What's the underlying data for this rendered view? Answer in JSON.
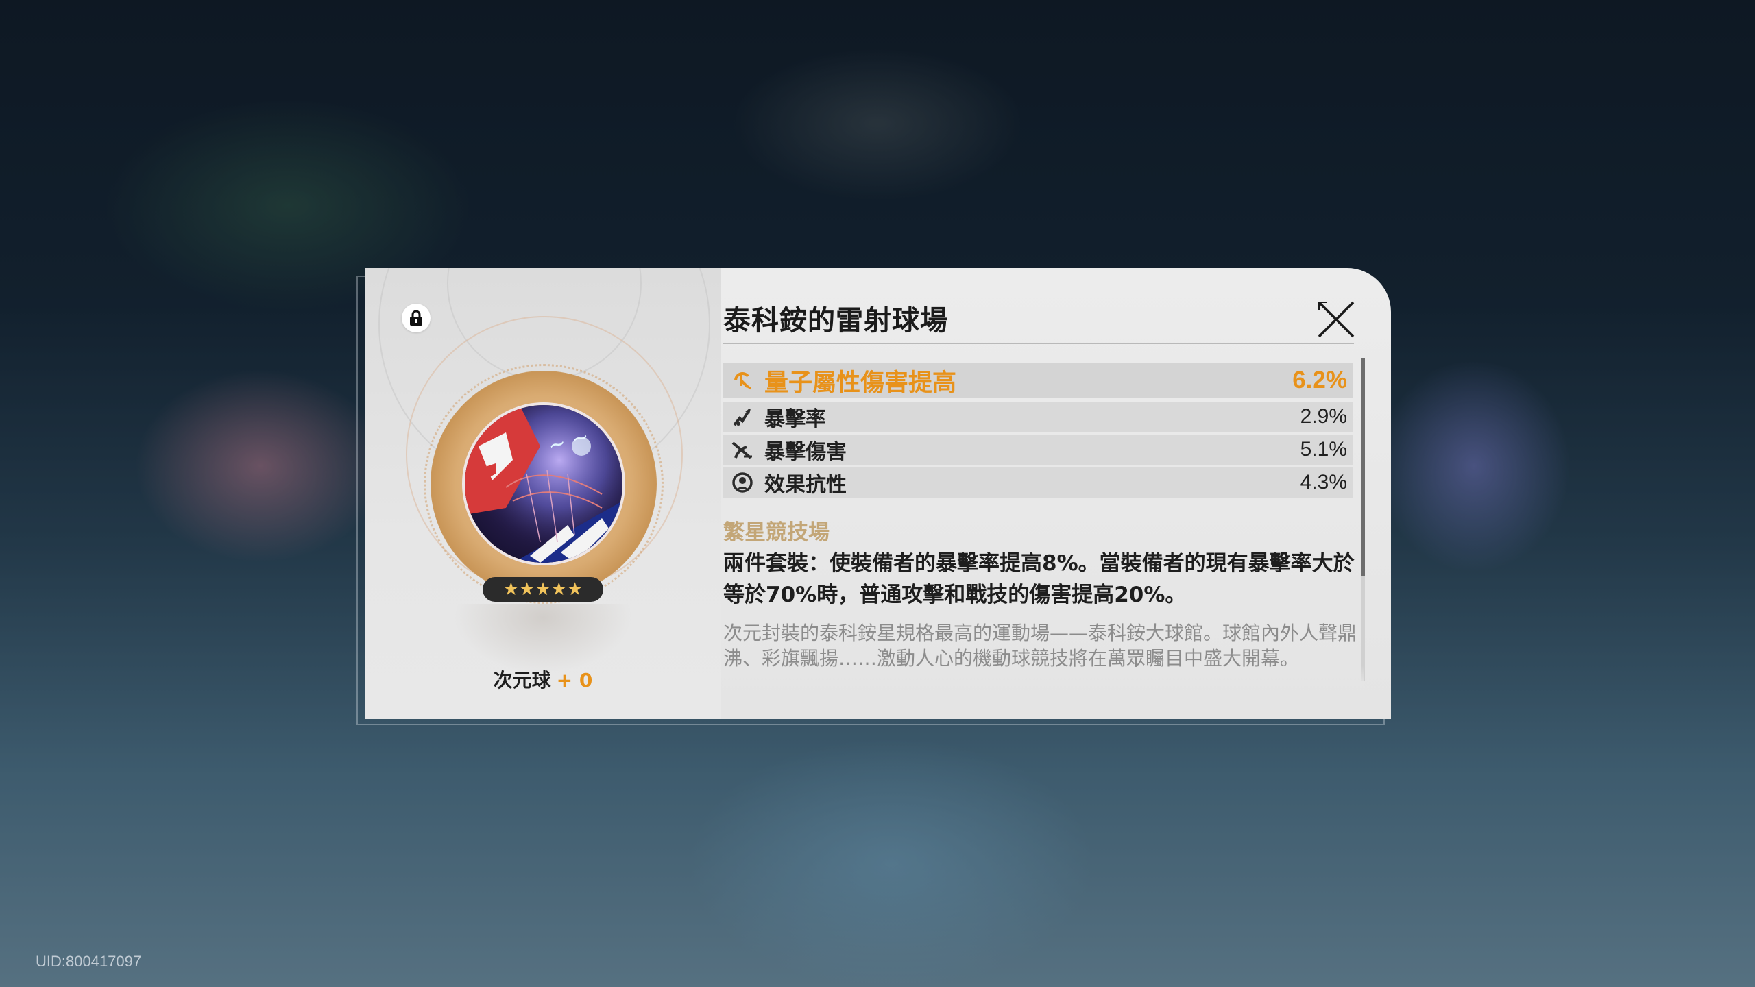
{
  "uid_text": "UID:800417097",
  "relic": {
    "title": "泰科銨的雷射球場",
    "locked_icon": "lock-icon",
    "stars": "★★★★★",
    "level_label": "次元球",
    "level_plus": "+ 0"
  },
  "stats": {
    "main": {
      "name": "量子屬性傷害提高",
      "value": "6.2%",
      "icon": "quantum-icon"
    },
    "subs": [
      {
        "name": "暴擊率",
        "value": "2.9%",
        "icon": "crit-rate-icon"
      },
      {
        "name": "暴擊傷害",
        "value": "5.1%",
        "icon": "crit-damage-icon"
      },
      {
        "name": "效果抗性",
        "value": "4.3%",
        "icon": "effect-res-icon"
      }
    ]
  },
  "set": {
    "name": "繁星競技場",
    "effect": "兩件套裝：使裝備者的暴擊率提高8%。當裝備者的現有暴擊率大於等於70%時，普通攻擊和戰技的傷害提高20%。",
    "lore": "次元封裝的泰科銨星規格最高的運動場——泰科銨大球館。球館內外人聲鼎沸、彩旗飄揚……激動人心的機動球競技將在萬眾矚目中盛大開幕。"
  },
  "colors": {
    "accent_orange": "#e8921a",
    "set_gold": "#c3a677",
    "card_bg": "#e6e6e6"
  }
}
